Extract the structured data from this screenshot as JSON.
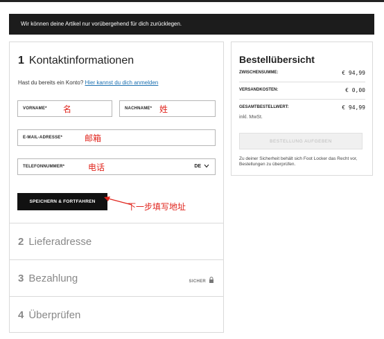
{
  "banner": {
    "text": "Wir können deine Artikel nur vorübergehend für dich zurücklegen."
  },
  "contact": {
    "step_number": "1",
    "title": "Kontaktinformationen",
    "account_prompt": "Hast du bereits ein Konto?",
    "login_link": "Hier kannst du dich anmelden",
    "fields": {
      "vorname": {
        "label": "VORNAME*",
        "note": "名"
      },
      "nachname": {
        "label": "NACHNAME*",
        "note": "姓"
      },
      "email": {
        "label": "E-MAIL-ADRESSE*",
        "note": "邮箱"
      },
      "phone": {
        "label": "TELEFONNUMMER*",
        "note": "电话",
        "country": "DE"
      }
    },
    "save_button": "SPEICHERN & FORTFAHREN",
    "arrow_note": "下一步填写地址"
  },
  "steps": [
    {
      "number": "2",
      "label": "Lieferadresse"
    },
    {
      "number": "3",
      "label": "Bezahlung",
      "badge": "SICHER"
    },
    {
      "number": "4",
      "label": "Überprüfen"
    }
  ],
  "summary": {
    "title": "Bestellübersicht",
    "subtotal_label": "ZWISCHENSUMME:",
    "subtotal_value": "€ 94,99",
    "shipping_label": "VERSANDKOSTEN:",
    "shipping_value": "€ 0,00",
    "total_label": "GESAMTBESTELLWERT:",
    "total_value": "€ 94,99",
    "incl_vat": "inkl. MwSt.",
    "order_button": "BESTELLUNG AUFGEBEN",
    "privacy_note": "Zu deiner Sicherheit behält sich Foot Locker das Recht vor, Bestellungen zu überprüfen."
  },
  "colors": {
    "annotation": "#e0241c",
    "link": "#1a6fb0",
    "banner_bg": "#1c1c1c"
  },
  "icons": {
    "phone_dropdown": "chevron-down-icon",
    "secure": "lock-icon"
  }
}
